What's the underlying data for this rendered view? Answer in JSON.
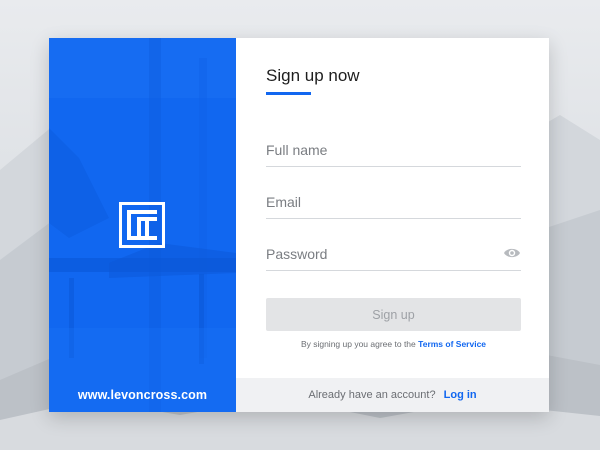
{
  "left_panel": {
    "website": "www.levoncross.com",
    "logo_icon": "lc-monogram-logo-icon"
  },
  "form": {
    "title": "Sign up now",
    "fields": {
      "full_name_placeholder": "Full name",
      "email_placeholder": "Email",
      "password_placeholder": "Password"
    },
    "password_toggle_icon": "eye-icon",
    "signup_label": "Sign up",
    "terms_prefix": "By signing up you agree to the",
    "terms_link": "Terms of Service"
  },
  "footer": {
    "prompt": "Already have an account?",
    "login_label": "Log in"
  },
  "colors": {
    "accent": "#1167f0",
    "disabled_button": "#e3e4e6",
    "footer_bg": "#f0f1f3"
  }
}
